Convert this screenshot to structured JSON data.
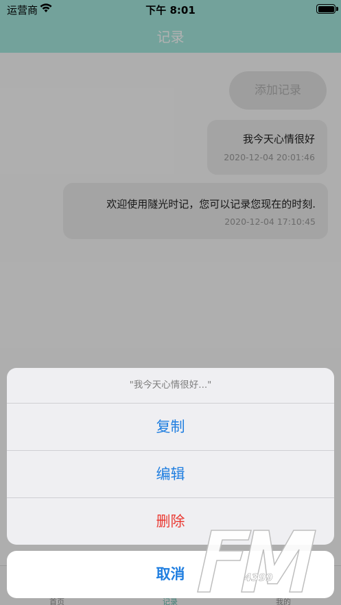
{
  "status_bar": {
    "carrier": "运营商",
    "time": "下午 8:01"
  },
  "nav": {
    "title": "记录"
  },
  "add_button": {
    "label": "添加记录"
  },
  "records": [
    {
      "text": "我今天心情很好",
      "timestamp": "2020-12-04 20:01:46"
    },
    {
      "text": "欢迎使用隧光时记，您可以记录您现在的时刻.",
      "timestamp": "2020-12-04 17:10:45"
    }
  ],
  "tab_bar": {
    "items": [
      {
        "label": "首页"
      },
      {
        "label": "记录"
      },
      {
        "label": "我的"
      }
    ]
  },
  "action_sheet": {
    "title": "\"我今天心情很好...\"",
    "actions": [
      {
        "label": "复制"
      },
      {
        "label": "编辑"
      },
      {
        "label": "删除"
      }
    ],
    "cancel": "取消"
  },
  "colors": {
    "nav": "#a5e8de",
    "accent": "#1f7ee0",
    "destructive": "#ea3a33"
  }
}
